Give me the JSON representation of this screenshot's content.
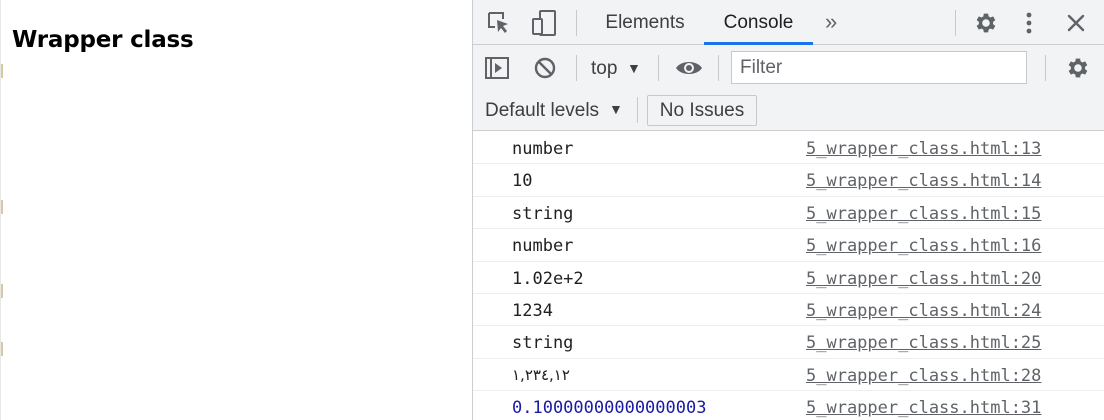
{
  "page": {
    "title": "Wrapper class"
  },
  "devtools": {
    "tabs": [
      {
        "label": "Elements",
        "active": false
      },
      {
        "label": "Console",
        "active": true
      }
    ],
    "more_tabs_glyph": "»",
    "toolbar": {
      "context_label": "top",
      "filter_placeholder": "Filter",
      "filter_value": "",
      "levels_label": "Default levels",
      "issues_label": "No Issues"
    },
    "icons": {
      "inspect": "inspect-element-icon",
      "device": "device-toolbar-icon",
      "settings": "gear-icon",
      "menu": "kebab-menu-icon",
      "close": "close-icon",
      "sidebar": "show-sidebar-icon",
      "clear": "clear-console-icon",
      "eye": "live-expression-icon",
      "console_settings": "console-settings-icon"
    },
    "colors": {
      "accent": "#1a73e8",
      "number_output": "#1a1aa6",
      "toolbar_bg": "#f1f3f4"
    },
    "log_entries": [
      {
        "message": "number",
        "source": "5_wrapper_class.html:13",
        "kind": "text"
      },
      {
        "message": "10",
        "source": "5_wrapper_class.html:14",
        "kind": "text"
      },
      {
        "message": "string",
        "source": "5_wrapper_class.html:15",
        "kind": "text"
      },
      {
        "message": "number",
        "source": "5_wrapper_class.html:16",
        "kind": "text"
      },
      {
        "message": "1.02e+2",
        "source": "5_wrapper_class.html:20",
        "kind": "text"
      },
      {
        "message": "1234",
        "source": "5_wrapper_class.html:24",
        "kind": "text"
      },
      {
        "message": "string",
        "source": "5_wrapper_class.html:25",
        "kind": "text"
      },
      {
        "message": "١,٢٣٤,١٢",
        "source": "5_wrapper_class.html:28",
        "kind": "rtl"
      },
      {
        "message": "0.10000000000000003",
        "source": "5_wrapper_class.html:31",
        "kind": "number"
      }
    ]
  }
}
